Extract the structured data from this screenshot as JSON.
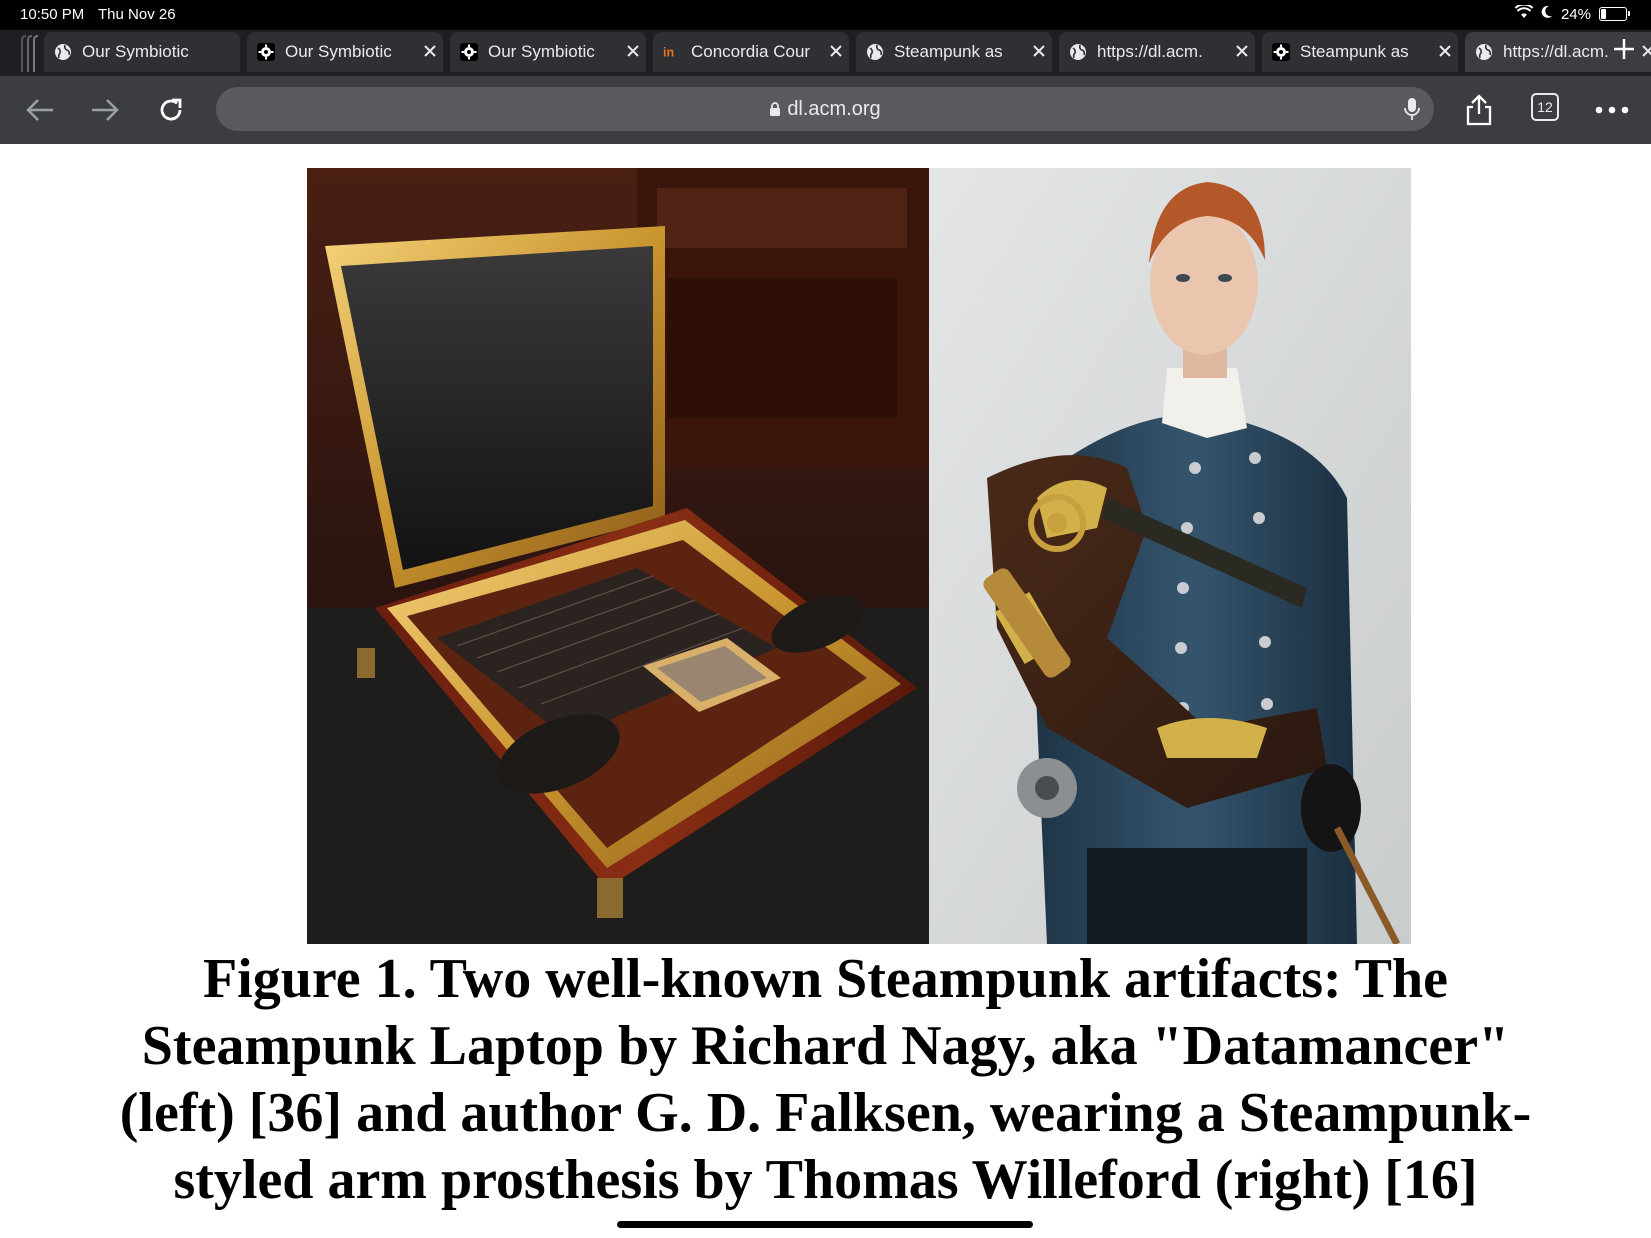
{
  "status_bar": {
    "time": "10:50 PM",
    "date": "Thu Nov 26",
    "battery": "24%",
    "battery_level": 0.24
  },
  "tabs": [
    {
      "title": "Our Symbiotic",
      "favicon": "globe-icon",
      "active": false
    },
    {
      "title": "Our Symbiotic",
      "favicon": "gear-badge-icon",
      "active": false
    },
    {
      "title": "Our Symbiotic",
      "favicon": "gear-badge-icon",
      "active": false
    },
    {
      "title": "Concordia Cour",
      "favicon": "in-logo-icon",
      "active": false
    },
    {
      "title": "Steampunk as",
      "favicon": "globe-icon",
      "active": false
    },
    {
      "title": "https://dl.acm.",
      "favicon": "globe-icon",
      "active": false
    },
    {
      "title": "Steampunk as",
      "favicon": "gear-badge-icon",
      "active": false
    },
    {
      "title": "https://dl.acm.",
      "favicon": "globe-icon",
      "active": true
    }
  ],
  "toolbar": {
    "url": "dl.acm.org",
    "tab_count": "12"
  },
  "figure": {
    "caption": "Figure 1. Two well-known Steampunk artifacts: The Steampunk Laptop by Richard Nagy, aka \"Datamancer\" (left) [36] and author G. D. Falksen, wearing a Steampunk-styled arm prosthesis by Thomas Willeford (right) [16]",
    "left_image": "steampunk-laptop-photo",
    "right_image": "steampunk-arm-prosthesis-photo"
  },
  "colors": {
    "status_bar": "#000000",
    "tab_strip": "#1e1f22",
    "toolbar": "#3c3d41",
    "omnibox": "#595a5e",
    "accent_orange": "#e8711c"
  }
}
